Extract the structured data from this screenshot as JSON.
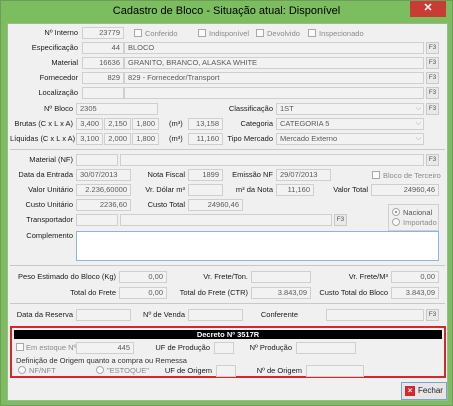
{
  "window": {
    "title": "Cadastro de Bloco - Situação atual: Disponível",
    "close": "✕"
  },
  "row1": {
    "label": "Nº Interno",
    "value": "23779",
    "conferido": "Conferido",
    "indisponivel": "Indisponível",
    "devolvido": "Devolvido",
    "inspecionado": "Inspecionado"
  },
  "especificacao": {
    "label": "Especificação",
    "code": "44",
    "text": "BLOCO",
    "f3": "F3"
  },
  "material": {
    "label": "Material",
    "code": "16636",
    "text": "GRANITO, BRANCO, ALASKA WHITE",
    "f3": "F3"
  },
  "fornecedor": {
    "label": "Fornecedor",
    "code": "829",
    "text": "829 - Fornecedor/Transport",
    "f3": "F3"
  },
  "localizacao": {
    "label": "Localização",
    "f3": "F3"
  },
  "bloco": {
    "label": "Nº Bloco",
    "value": "2305",
    "classif_label": "Classificação",
    "classif_value": "1ST",
    "categoria_label": "Categoria",
    "categoria_value": "CATEGORIA 5",
    "tipo_label": "Tipo Mercado",
    "tipo_value": "Mercado Externo",
    "f3": "F3"
  },
  "brutas": {
    "label": "Brutas (C x L x A)",
    "c": "3,400",
    "l": "2,150",
    "a": "1,800",
    "m3": "(m³)",
    "vol": "13,158"
  },
  "liquidas": {
    "label": "Líquidas (C x L x A)",
    "c": "3,100",
    "l": "2,000",
    "a": "1,800",
    "m3": "(m³)",
    "vol": "11,160"
  },
  "material_nf": {
    "label": "Material (NF)",
    "f3": "F3"
  },
  "entrada": {
    "label": "Data da Entrada",
    "value": "30/07/2013",
    "nf_label": "Nota Fiscal",
    "nf_value": "1899",
    "emissao_label": "Emissão NF",
    "emissao_value": "29/07/2013",
    "terceiro": "Bloco de Terceiro"
  },
  "valor": {
    "label": "Valor Unitário",
    "value": "2.236,60000",
    "dolar_label": "Vr. Dólar m³",
    "m3nota_label": "m³ da Nota",
    "m3nota_value": "11,160",
    "total_label": "Valor Total",
    "total_value": "24960,46"
  },
  "custo": {
    "label": "Custo Unitário",
    "value": "2236,60",
    "total_label": "Custo Total",
    "total_value": "24960,46"
  },
  "transportador": {
    "label": "Transportador",
    "f3": "F3",
    "nacional": "Nacional",
    "importado": "Importado"
  },
  "complemento": {
    "label": "Complemento"
  },
  "peso": {
    "label": "Peso Estimado do Bloco (Kg)",
    "value": "0,00",
    "frete_ton_label": "Vr. Frete/Ton.",
    "frete_m3_label": "Vr. Frete/M³",
    "frete_m3_value": "0,00"
  },
  "frete": {
    "label": "Total do Frete",
    "value": "0,00",
    "ctr_label": "Total do Frete (CTR)",
    "ctr_value": "3.843,09",
    "custo_label": "Custo Total do Bloco",
    "custo_value": "3.843,09"
  },
  "reserva": {
    "label": "Data da Reserva",
    "venda_label": "Nº de Venda",
    "conferente_label": "Conferente",
    "f3": "F3"
  },
  "decreto": {
    "title": "Decreto Nº 3517R",
    "estoque_label": "Em estoque Nº",
    "estoque_value": "445",
    "uf_prod_label": "UF de Produção",
    "n_prod_label": "Nº Produção",
    "origem_label": "Definição de Origem quanto a compra ou Remessa",
    "nfnft": "NF/NFT",
    "estoque_opt": "\"ESTOQUE\"",
    "uf_origem_label": "UF de Origem",
    "n_origem_label": "Nº de Origem"
  },
  "footer": {
    "fechar": "Fechar"
  }
}
